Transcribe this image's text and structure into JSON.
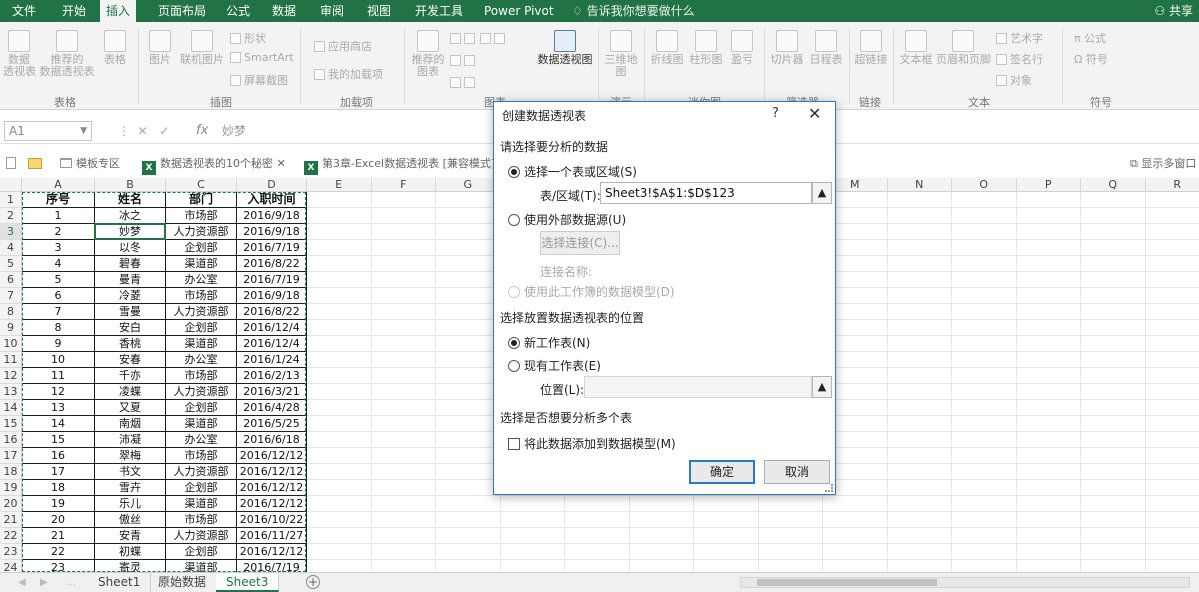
{
  "tabs": [
    "文件",
    "开始",
    "插入",
    "页面布局",
    "公式",
    "数据",
    "审阅",
    "视图",
    "开发工具",
    "Power Pivot"
  ],
  "tell_me": "告诉我你想要做什么",
  "share": "共享",
  "ribbon": {
    "buttons": {
      "pivot_table": "数据\n透视表",
      "recommended_pivot": "推荐的\n数据透视表",
      "table": "表格",
      "picture": "图片",
      "online_picture": "联机图片",
      "recommended_chart": "推荐的\n图表",
      "pivot_chart": "数据透视图",
      "map3d": "三维地\n图",
      "line": "折线图",
      "column": "柱形图",
      "winloss": "盈亏",
      "slicer": "切片器",
      "timeline": "日程表",
      "hyperlink": "超链接",
      "textbox": "文本框",
      "header_footer": "页眉和页脚"
    },
    "small": {
      "shapes": "形状",
      "smartart": "SmartArt",
      "screenshot": "屏幕截图",
      "store": "应用商店",
      "my_addins": "我的加载项",
      "wordart": "艺术字",
      "signature": "签名行",
      "object": "对象",
      "equation": "公式",
      "symbol": "符号"
    },
    "groups": {
      "tables": "表格",
      "illustrations": "插图",
      "addins": "加载项",
      "charts": "图表",
      "tours": "演示",
      "sparklines": "迷你图",
      "filters": "筛选器",
      "links": "链接",
      "text": "文本",
      "symbols": "符号"
    }
  },
  "formula_bar": {
    "name_box": "A1",
    "formula": "妙梦"
  },
  "doc_tabs": {
    "template": "模板专区",
    "doc1": "数据透视表的10个秘密",
    "doc2": "第3章-Excel数据透视表 [兼容模式]",
    "multi_window": "显示多窗口"
  },
  "columns": [
    "A",
    "B",
    "C",
    "D",
    "E",
    "F",
    "G",
    "H",
    "I",
    "J",
    "K",
    "L",
    "M",
    "N",
    "O",
    "P",
    "Q",
    "R"
  ],
  "table": {
    "headers": [
      "序号",
      "姓名",
      "部门",
      "入职时间"
    ],
    "rows": [
      [
        "1",
        "冰之",
        "市场部",
        "2016/9/18"
      ],
      [
        "2",
        "妙梦",
        "人力资源部",
        "2016/9/18"
      ],
      [
        "3",
        "以冬",
        "企划部",
        "2016/7/19"
      ],
      [
        "4",
        "碧春",
        "渠道部",
        "2016/8/22"
      ],
      [
        "5",
        "曼青",
        "办公室",
        "2016/7/19"
      ],
      [
        "6",
        "冷菱",
        "市场部",
        "2016/9/18"
      ],
      [
        "7",
        "雪曼",
        "人力资源部",
        "2016/8/22"
      ],
      [
        "8",
        "安白",
        "企划部",
        "2016/12/4"
      ],
      [
        "9",
        "香桃",
        "渠道部",
        "2016/12/4"
      ],
      [
        "10",
        "安春",
        "办公室",
        "2016/1/24"
      ],
      [
        "11",
        "千亦",
        "市场部",
        "2016/2/13"
      ],
      [
        "12",
        "凌蝶",
        "人力资源部",
        "2016/3/21"
      ],
      [
        "13",
        "又夏",
        "企划部",
        "2016/4/28"
      ],
      [
        "14",
        "南烟",
        "渠道部",
        "2016/5/25"
      ],
      [
        "15",
        "沛凝",
        "办公室",
        "2016/6/18"
      ],
      [
        "16",
        "翠梅",
        "市场部",
        "2016/12/12"
      ],
      [
        "17",
        "书文",
        "人力资源部",
        "2016/12/12"
      ],
      [
        "18",
        "雪卉",
        "企划部",
        "2016/12/12"
      ],
      [
        "19",
        "乐儿",
        "渠道部",
        "2016/12/12"
      ],
      [
        "20",
        "傲丝",
        "市场部",
        "2016/10/22"
      ],
      [
        "21",
        "安青",
        "人力资源部",
        "2016/11/27"
      ],
      [
        "22",
        "初蝶",
        "企划部",
        "2016/12/12"
      ],
      [
        "23",
        "寄灵",
        "渠道部",
        "2016/7/19"
      ]
    ]
  },
  "sheets": [
    "Sheet1",
    "原始数据",
    "Sheet3"
  ],
  "dialog": {
    "title": "创建数据透视表",
    "help": "?",
    "close": "✕",
    "section1": "请选择要分析的数据",
    "opt_select_table": "选择一个表或区域(S)",
    "table_range_label": "表/区域(T):",
    "table_range_value": "Sheet3!$A$1:$D$123",
    "opt_external": "使用外部数据源(U)",
    "choose_conn": "选择连接(C)...",
    "conn_name": "连接名称:",
    "opt_data_model": "使用此工作簿的数据模型(D)",
    "section2": "选择放置数据透视表的位置",
    "opt_new_sheet": "新工作表(N)",
    "opt_existing_sheet": "现有工作表(E)",
    "location_label": "位置(L):",
    "section3": "选择是否想要分析多个表",
    "add_to_model": "将此数据添加到数据模型(M)",
    "ok": "确定",
    "cancel": "取消"
  }
}
